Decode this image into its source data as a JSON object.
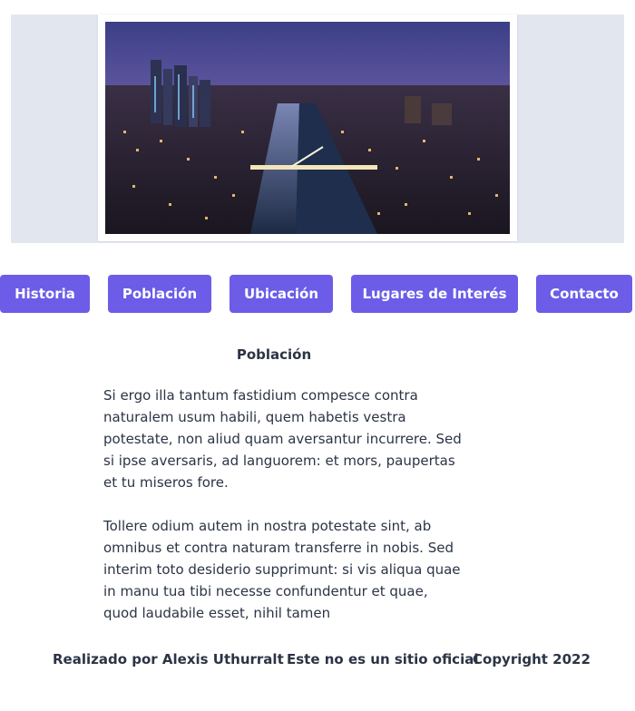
{
  "hero": {
    "image_alt": "Puerto Madero, Buenos Aires at night"
  },
  "nav": {
    "items": [
      {
        "label": "Historia"
      },
      {
        "label": "Población"
      },
      {
        "label": "Ubicación"
      },
      {
        "label": "Lugares de Interés"
      },
      {
        "label": "Contacto"
      }
    ]
  },
  "main": {
    "title": "Población",
    "paragraphs": [
      "Si ergo illa tantum fastidium compesce contra naturalem usum habili, quem habetis vestra potestate, non aliud quam aversantur incurrere. Sed si ipse aversaris, ad languorem: et mors, paupertas et tu miseros fore.",
      "Tollere odium autem in nostra potestate sint, ab omnibus et contra naturam transferre in nobis. Sed interim toto desiderio supprimunt: si vis aliqua quae in manu tua tibi necesse confundentur et quae, quod laudabile esset, nihil tamen"
    ]
  },
  "footer": {
    "author": "Realizado por Alexis Uthurralt",
    "disclaimer": "Este no es un sitio oficial",
    "copyright": "Copyright 2022"
  },
  "colors": {
    "nav_button": "#6c5ce7",
    "hero_background": "#e2e7ef",
    "text": "#2b3445"
  }
}
